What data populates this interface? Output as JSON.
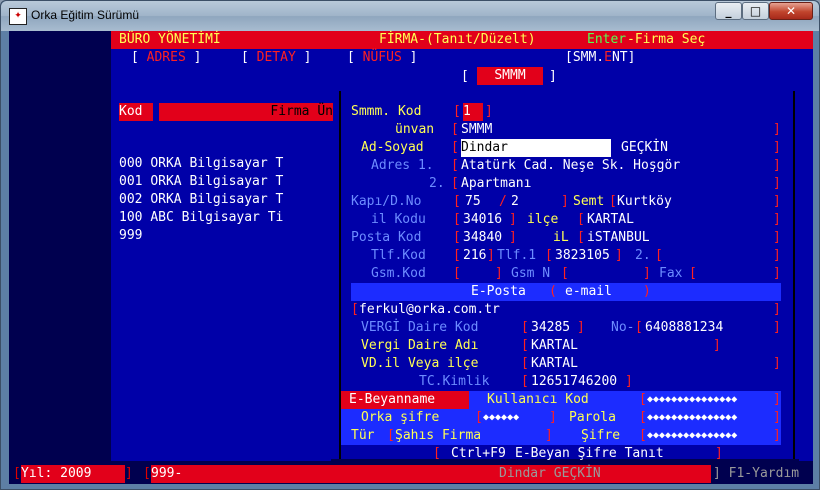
{
  "window": {
    "title": "Orka Eğitim Sürümü",
    "icon": "orka-app-icon"
  },
  "header": {
    "left": "BÜRO YÖNETİMİ",
    "center": "FİRMA-(Tanıt/Düzelt)",
    "enter_key": "Enter",
    "right": "-Firma Seç"
  },
  "tabs": [
    {
      "open": "[",
      "first": "A",
      "rest": "DRES",
      "close": "]"
    },
    {
      "open": "[",
      "first": "D",
      "rest": "ETAY",
      "close": "]"
    },
    {
      "open": "[",
      "first": "N",
      "rest": "ÜFUS",
      "close": "]"
    },
    {
      "label": "SMMM"
    },
    {
      "open": "[",
      "pre": "SMM.",
      "first": "E",
      "rest": "NT",
      "close": "]"
    }
  ],
  "firm_list": {
    "col_kod": "Kod",
    "col_unvan": "Firma Ün",
    "rows": [
      {
        "kod": "000",
        "name": "ORKA Bilgisayar T"
      },
      {
        "kod": "001",
        "name": "ORKA Bilgisayar T"
      },
      {
        "kod": "002",
        "name": "ORKA Bilgisayar T"
      },
      {
        "kod": "100",
        "name": "ABC Bilgisayar Ti"
      },
      {
        "kod": "999",
        "name": ""
      }
    ]
  },
  "smmm_form": {
    "smmm_kod": {
      "label": "Smmm. Kod",
      "value": "1"
    },
    "unvan": {
      "label": "ünvan",
      "value": "SMMM"
    },
    "ad_soyad": {
      "label": "Ad-Soyad",
      "ad": "Dindar",
      "soyad": "GEÇKİN"
    },
    "adres1": {
      "label": "Adres 1.",
      "value": "Atatürk Cad. Neşe Sk. Hoşgör"
    },
    "adres2": {
      "label": "2.",
      "value": "Apartmanı"
    },
    "kapi": {
      "label": "Kapı/D.No",
      "kapi": "75",
      "daire": "2"
    },
    "semt": {
      "label": "Semt",
      "value": "Kurtköy"
    },
    "il_kodu": {
      "label": "il Kodu",
      "value": "34016"
    },
    "ilce": {
      "label": "ilçe",
      "value": "KARTAL"
    },
    "posta_kod": {
      "label": "Posta Kod",
      "value": "34840"
    },
    "il": {
      "label": "iL",
      "value": "iSTANBUL"
    },
    "tlf_kod": {
      "label": "Tlf.Kod",
      "value": "216"
    },
    "tlf1": {
      "label": "Tlf.1",
      "value": "3823105"
    },
    "tlf2": {
      "label": "2.",
      "value": ""
    },
    "gsm_kod": {
      "label": "Gsm.Kod",
      "value": ""
    },
    "gsm_n": {
      "label": "Gsm N",
      "value": ""
    },
    "fax": {
      "label": "Fax",
      "value": ""
    },
    "eposta": {
      "label": "E-Posta",
      "sub": "e-mail",
      "value": "ferkul@orka.com.tr"
    },
    "vergi_daire_kod": {
      "label": "VERGİ Daire Kod",
      "value": "34285"
    },
    "vergi_no": {
      "label": "No-",
      "value": "6408881234"
    },
    "vergi_daire_adi": {
      "label": "Vergi Daire Adı",
      "value": "KARTAL"
    },
    "vd_il": {
      "label": "VD.il Veya ilçe",
      "value": "KARTAL"
    },
    "tc_kimlik": {
      "label": "TC.Kimlik",
      "value": "12651746200"
    },
    "e_beyanname": {
      "label": "E-Beyanname",
      "kullanici_label": "Kullanıcı Kod",
      "kullanici_value": "◆◆◆◆◆◆◆◆◆◆◆◆◆◆◆"
    },
    "orka_sifre": {
      "label": "Orka şifre",
      "value": "◆◆◆◆◆◆",
      "parola_label": "Parola",
      "parola_value": "◆◆◆◆◆◆◆◆◆◆◆◆◆◆◆"
    },
    "tur": {
      "label": "Tür",
      "value": "Şahıs Firma",
      "sifre_label": "Şifre",
      "sifre_value": "◆◆◆◆◆◆◆◆◆◆◆◆◆◆◆"
    },
    "hint": {
      "key": "Ctrl+F9",
      "text": "E-Beyan Şifre Tanıt"
    }
  },
  "statusbar": {
    "yil_label": "Yıl:",
    "yil": "2009",
    "firma": "999-",
    "user": "Dindar GEÇKİN",
    "help": "F1-Yardım"
  }
}
